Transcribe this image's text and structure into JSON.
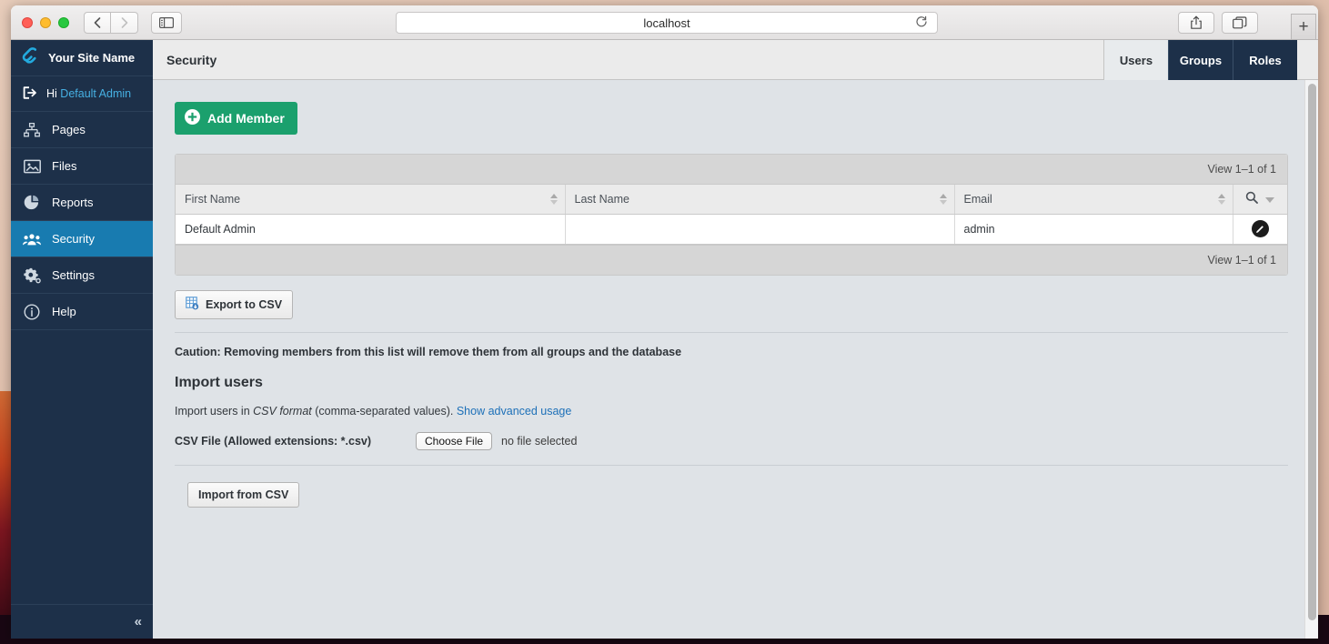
{
  "browser": {
    "url": "localhost",
    "back_icon": "chevron-left-icon",
    "forward_icon": "chevron-right-icon",
    "sidebar_toggle_icon": "sidebar-icon",
    "reload_icon": "reload-icon",
    "share_icon": "share-icon",
    "tabs_icon": "tab-overview-icon",
    "new_tab_label": "+"
  },
  "sidebar": {
    "brand": "Your Site Name",
    "brand_icon": "silverstripe-logo-icon",
    "user_greeting": "Hi",
    "user_name": "Default Admin",
    "logout_icon": "logout-icon",
    "collapse_label": "«",
    "items": [
      {
        "label": "Pages",
        "icon": "sitemap-icon",
        "active": false
      },
      {
        "label": "Files",
        "icon": "image-icon",
        "active": false
      },
      {
        "label": "Reports",
        "icon": "pie-chart-icon",
        "active": false
      },
      {
        "label": "Security",
        "icon": "people-icon",
        "active": true
      },
      {
        "label": "Settings",
        "icon": "gear-icon",
        "active": false
      },
      {
        "label": "Help",
        "icon": "info-icon",
        "active": false
      }
    ]
  },
  "header": {
    "title": "Security",
    "tabs": [
      {
        "label": "Users",
        "active": true
      },
      {
        "label": "Groups",
        "active": false
      },
      {
        "label": "Roles",
        "active": false
      }
    ]
  },
  "toolbar": {
    "add_member_label": "Add Member",
    "add_member_icon": "plus-circle-icon",
    "add_member_color": "#1ba06d"
  },
  "grid": {
    "view_count_top": "View 1–1 of 1",
    "view_count_bottom": "View 1–1 of 1",
    "search_icon": "search-icon",
    "search_caret_icon": "caret-down-icon",
    "columns": [
      "First Name",
      "Last Name",
      "Email"
    ],
    "rows": [
      {
        "first_name": "Default Admin",
        "last_name": "",
        "email": "admin",
        "action_icon": "edit-pencil-icon"
      }
    ]
  },
  "export": {
    "label": "Export to CSV",
    "icon": "spreadsheet-export-icon"
  },
  "caution": "Caution: Removing members from this list will remove them from all groups and the database",
  "import": {
    "title": "Import users",
    "desc_pre": "Import users in ",
    "desc_italic": "CSV format",
    "desc_post": " (comma-separated values). ",
    "advanced_link": "Show advanced usage",
    "file_label": "CSV File (Allowed extensions: *.csv)",
    "choose_file_label": "Choose File",
    "no_file_label": "no file selected",
    "submit_label": "Import from CSV"
  }
}
